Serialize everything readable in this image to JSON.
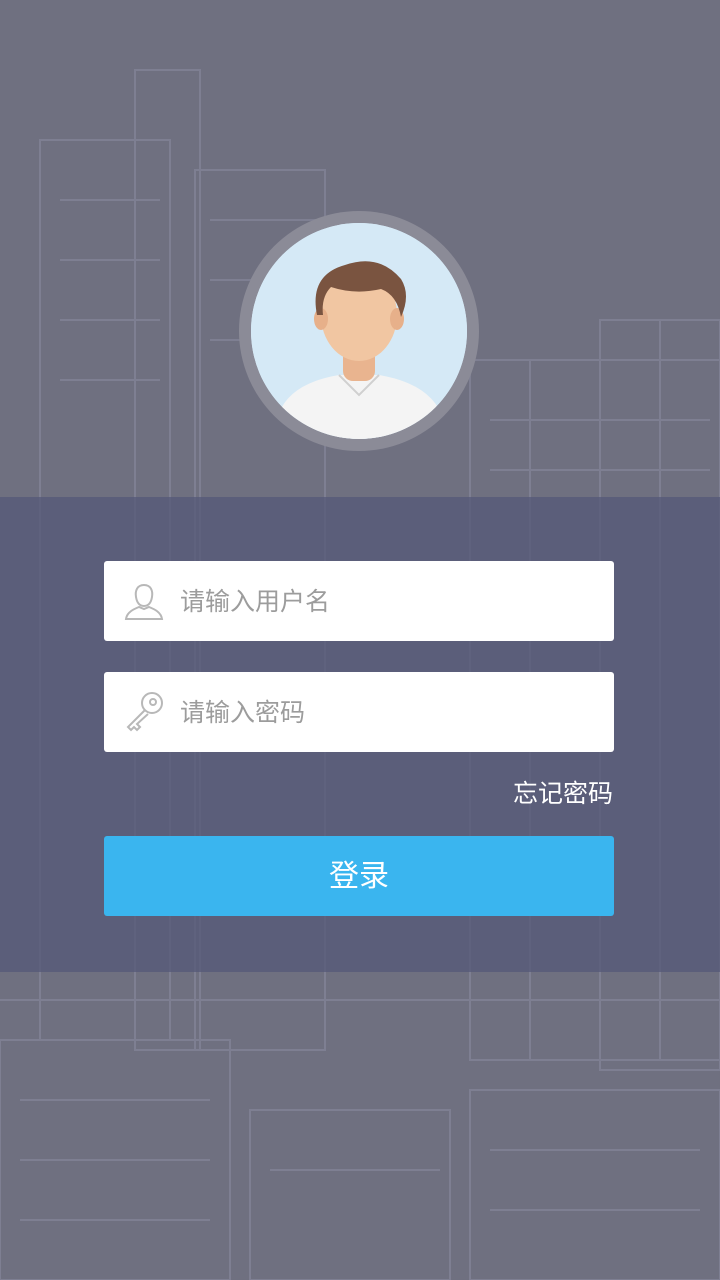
{
  "login": {
    "username_placeholder": "请输入用户名",
    "password_placeholder": "请输入密码",
    "forgot_password": "忘记密码",
    "login_button": "登录"
  },
  "icons": {
    "username": "user-icon",
    "password": "key-icon",
    "avatar": "avatar-icon"
  },
  "colors": {
    "background": "#6f7080",
    "band": "#565a78",
    "accent": "#3ab5ef",
    "avatar_bg": "#d5e9f6"
  }
}
